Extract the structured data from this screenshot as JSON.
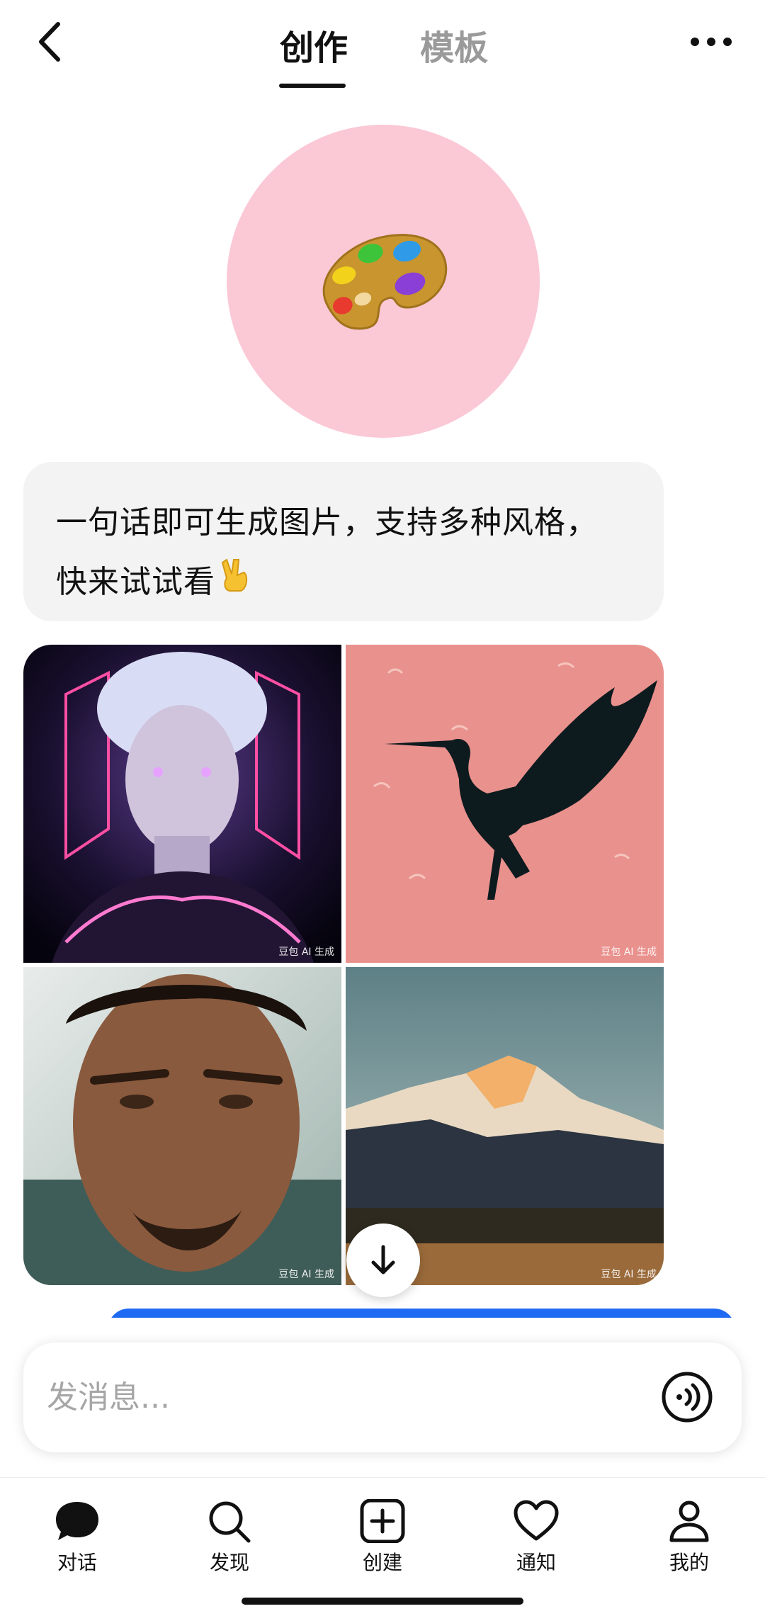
{
  "header": {
    "tabs": [
      {
        "label": "创作",
        "active": true
      },
      {
        "label": "模板",
        "active": false
      }
    ]
  },
  "intro": {
    "line1": "一句话即可生成图片，支持多种风格，",
    "line2": "快来试试看"
  },
  "gallery": {
    "watermark": "豆包 AI 生成",
    "images": [
      "cyberpunk-portrait",
      "crane-silhouette",
      "man-portrait",
      "mountain-landscape"
    ]
  },
  "input": {
    "placeholder": "发消息..."
  },
  "nav": {
    "items": [
      {
        "label": "对话",
        "icon": "chat-bubble-icon"
      },
      {
        "label": "发现",
        "icon": "search-icon"
      },
      {
        "label": "创建",
        "icon": "plus-square-icon"
      },
      {
        "label": "通知",
        "icon": "heart-icon"
      },
      {
        "label": "我的",
        "icon": "person-icon"
      }
    ]
  },
  "colors": {
    "avatar_bg": "#fbc8d6",
    "bubble_bg": "#f3f3f4",
    "accent_blue": "#1f6af2"
  }
}
